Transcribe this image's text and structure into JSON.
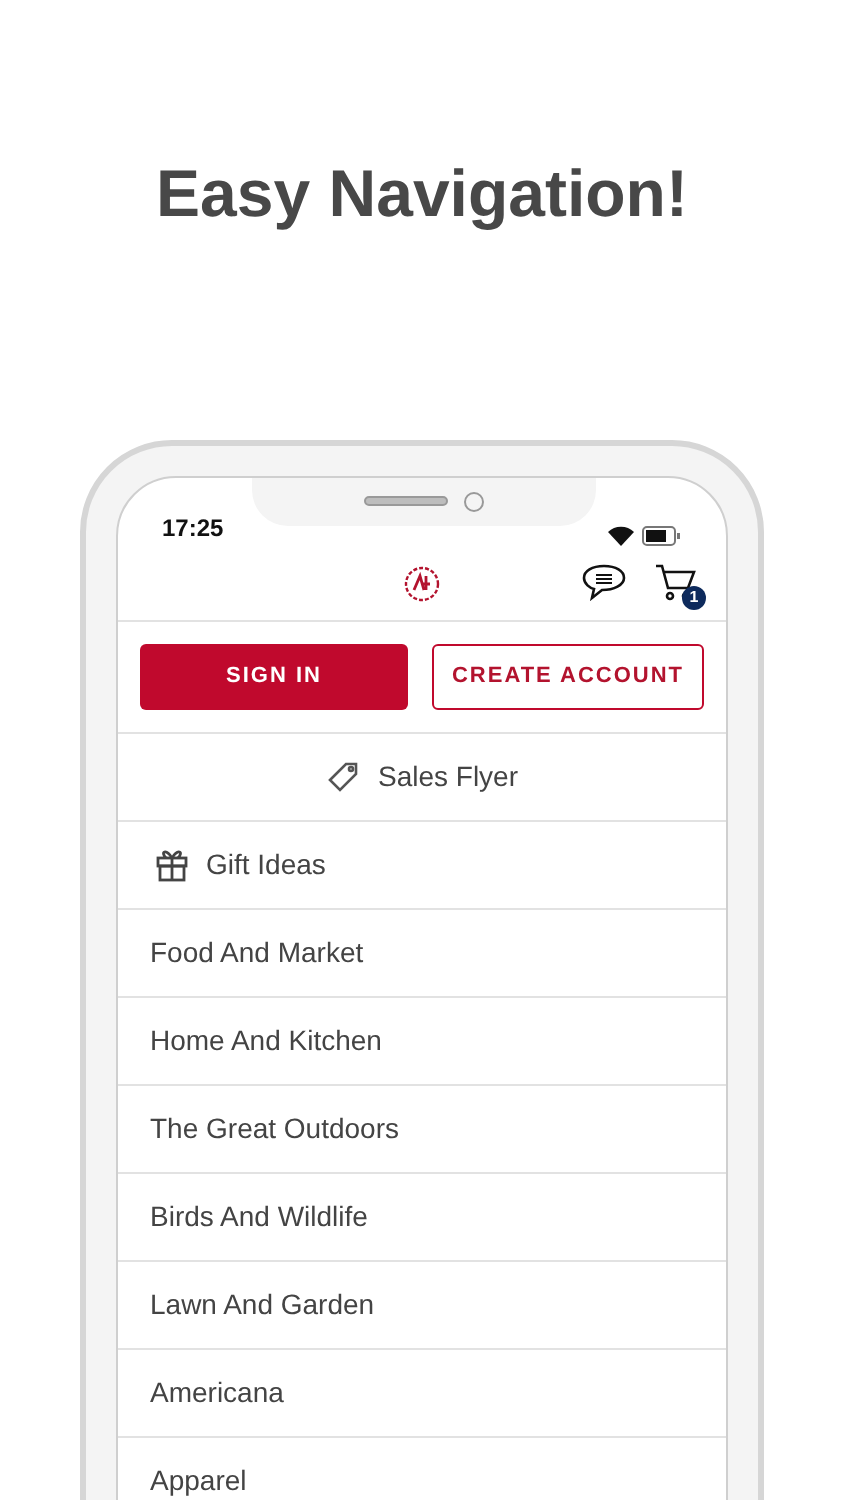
{
  "headline": "Easy Navigation!",
  "status_bar": {
    "time": "17:25"
  },
  "header": {
    "cart_count": "1"
  },
  "buttons": {
    "sign_in": "SIGN IN",
    "create_account": "CREATE ACCOUNT"
  },
  "menu": [
    {
      "label": "Sales Flyer",
      "kind": "flyer"
    },
    {
      "label": "Gift Ideas",
      "kind": "gift"
    },
    {
      "label": "Food And Market",
      "kind": "plain"
    },
    {
      "label": "Home And Kitchen",
      "kind": "plain"
    },
    {
      "label": "The Great Outdoors",
      "kind": "plain"
    },
    {
      "label": "Birds And Wildlife",
      "kind": "plain"
    },
    {
      "label": "Lawn And Garden",
      "kind": "plain"
    },
    {
      "label": "Americana",
      "kind": "plain"
    },
    {
      "label": "Apparel",
      "kind": "plain"
    }
  ]
}
